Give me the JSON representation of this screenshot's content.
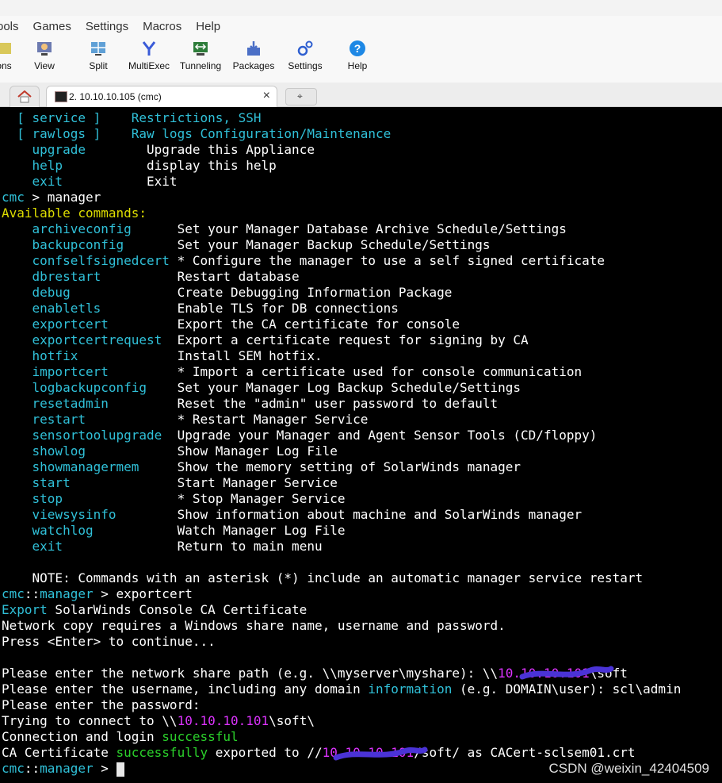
{
  "menu": [
    "ools",
    "Games",
    "Settings",
    "Macros",
    "Help"
  ],
  "toolbar": {
    "items": [
      {
        "label": "ons"
      },
      {
        "label": "View"
      },
      {
        "label": "Split"
      },
      {
        "label": "MultiExec"
      },
      {
        "label": "Tunneling"
      },
      {
        "label": "Packages"
      },
      {
        "label": "Settings"
      },
      {
        "label": "Help"
      }
    ]
  },
  "tabs": {
    "session_label": "2. 10.10.10.105 (cmc)",
    "close": "×",
    "new": "⌖"
  },
  "terminal": {
    "l1a": "  [ ",
    "l1b": "service",
    "l1c": " ]    Restrictions, SSH",
    "l2a": "  [ ",
    "l2b": "rawlogs",
    "l2c": " ]    Raw logs Configuration/Maintenance",
    "l3a": "    ",
    "l3b": "upgrade",
    "l3c": "        Upgrade this Appliance",
    "l4a": "    ",
    "l4b": "help",
    "l4c": "           display this help",
    "l5a": "    ",
    "l5b": "exit",
    "l5c": "           Exit",
    "l6a": "cmc",
    "l6b": " > manager",
    "l7": "Available commands:",
    "cmds": [
      {
        "cmd": "archiveconfig",
        "pad": "      ",
        "desc": "Set your Manager Database Archive Schedule/Settings"
      },
      {
        "cmd": "backupconfig",
        "pad": "       ",
        "desc": "Set your Manager Backup Schedule/Settings"
      },
      {
        "cmd": "confselfsignedcert",
        "pad": " ",
        "desc": "* Configure the manager to use a self signed certificate"
      },
      {
        "cmd": "dbrestart",
        "pad": "          ",
        "desc": "Restart database"
      },
      {
        "cmd": "debug",
        "pad": "              ",
        "desc": "Create Debugging Information Package"
      },
      {
        "cmd": "enabletls",
        "pad": "          ",
        "desc": "Enable TLS for DB connections"
      },
      {
        "cmd": "exportcert",
        "pad": "         ",
        "desc": "Export the CA certificate for console"
      },
      {
        "cmd": "exportcertrequest",
        "pad": "  ",
        "desc": "Export a certificate request for signing by CA"
      },
      {
        "cmd": "hotfix",
        "pad": "             ",
        "desc": "Install SEM hotfix."
      },
      {
        "cmd": "importcert",
        "pad": "         ",
        "desc": "* Import a certificate used for console communication"
      },
      {
        "cmd": "logbackupconfig",
        "pad": "    ",
        "desc": "Set your Manager Log Backup Schedule/Settings"
      },
      {
        "cmd": "resetadmin",
        "pad": "         ",
        "desc": "Reset the \"admin\" user password to default"
      },
      {
        "cmd": "restart",
        "pad": "            ",
        "desc": "* Restart Manager Service"
      },
      {
        "cmd": "sensortoolupgrade",
        "pad": "  ",
        "desc": "Upgrade your Manager and Agent Sensor Tools (CD/floppy)"
      },
      {
        "cmd": "showlog",
        "pad": "            ",
        "desc": "Show Manager Log File"
      },
      {
        "cmd": "showmanagermem",
        "pad": "     ",
        "desc": "Show the memory setting of SolarWinds manager"
      },
      {
        "cmd": "start",
        "pad": "              ",
        "desc": "Start Manager Service"
      },
      {
        "cmd": "stop",
        "pad": "               ",
        "desc": "* Stop Manager Service"
      },
      {
        "cmd": "viewsysinfo",
        "pad": "        ",
        "desc": "Show information about machine and SolarWinds manager"
      },
      {
        "cmd": "watchlog",
        "pad": "           ",
        "desc": "Watch Manager Log File"
      },
      {
        "cmd": "exit",
        "pad": "               ",
        "desc": "Return to main menu"
      }
    ],
    "note": "    NOTE: Commands with an asterisk (*) include an automatic manager service restart",
    "p1a": "cmc",
    "p1b": "::",
    "p1c": "manager",
    "p1d": " > exportcert",
    "e1a": "Export",
    "e1b": " SolarWinds Console CA Certificate",
    "n1": "Network copy requires a Windows share name, username and password.",
    "n2": "Press <Enter> to continue...",
    "s1a": "Please enter the network share path (e.g. \\\\myserver\\myshare): \\\\",
    "s1b": "10.10.10.101",
    "s1c": "\\soft",
    "s2a": "Please enter the username, including any domain ",
    "s2b": "information",
    "s2c": " (e.g. DOMAIN\\user): scl\\admin",
    "s3": "Please enter the password:",
    "s4a": "Trying to connect to \\\\",
    "s4b": "10.10.10.101",
    "s4c": "\\soft\\",
    "s5a": "Connection and login ",
    "s5b": "successful",
    "s6a": "CA Certificate ",
    "s6b": "successfully",
    "s6c": " exported to //",
    "s6d": "10.10.10.101",
    "s6e": "/soft/ as CACert-sclsem01.crt",
    "p2a": "cmc",
    "p2b": "::",
    "p2c": "manager",
    "p2d": " > "
  },
  "watermark": "CSDN @weixin_42404509"
}
